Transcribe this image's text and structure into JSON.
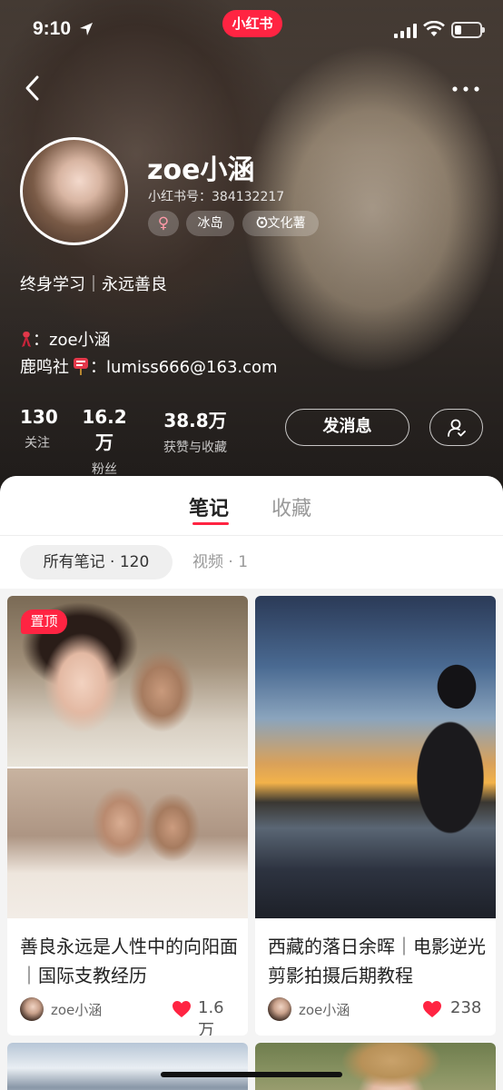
{
  "status_bar": {
    "time": "9:10"
  },
  "brand": {
    "label": "小红书",
    "color": "#ff2442"
  },
  "profile": {
    "name": "zoe小涵",
    "red_id": "小红书号：384132217",
    "tags": {
      "gender": "♀",
      "location": "冰岛",
      "title": "文化薯"
    },
    "bio": "终身学习｜永远善良",
    "info_line1_suffix": "：zoe小涵",
    "info_line2_prefix": "鹿鸣社",
    "info_line2_suffix": "：lumiss666@163.com"
  },
  "stats": {
    "following": {
      "value": "130",
      "label": "关注"
    },
    "fans": {
      "value": "16.2万",
      "label": "粉丝"
    },
    "likes": {
      "value": "38.8万",
      "label": "获赞与收藏"
    }
  },
  "actions": {
    "message": "发消息"
  },
  "tabs": {
    "notes": "笔记",
    "collections": "收藏"
  },
  "filters": {
    "all": "所有笔记 · 120",
    "video": "视频 · 1"
  },
  "notes": [
    {
      "pinned_label": "置顶",
      "title": "善良永远是人性中的向阳面｜国际支教经历",
      "author": "zoe小涵",
      "likes": "1.6万"
    },
    {
      "title": "西藏的落日余晖｜电影逆光剪影拍摄后期教程",
      "author": "zoe小涵",
      "likes": "238"
    }
  ],
  "icons": {
    "back": "chevron-left-icon",
    "more": "more-dots-icon",
    "follow": "user-check-icon",
    "heart": "heart-icon",
    "title_badge": "sparkle-badge-icon"
  },
  "colors": {
    "accent": "#ff2442",
    "heart": "#ff2442"
  }
}
